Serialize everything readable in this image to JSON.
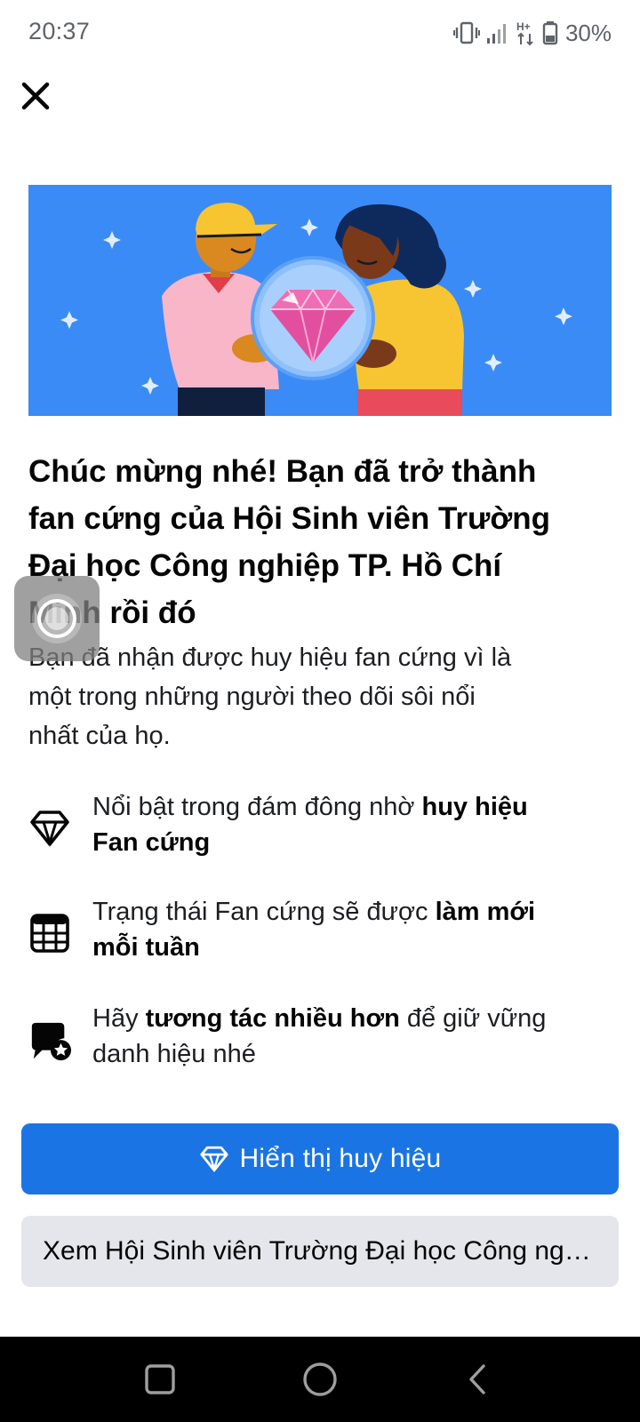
{
  "status_bar": {
    "time": "20:37",
    "battery": "30%",
    "icons": [
      "vibrate-icon",
      "signal-icon",
      "hplus-data-icon",
      "battery-icon"
    ]
  },
  "dialog": {
    "close_icon": "close-icon",
    "hero_icon": "fan-badge-illustration",
    "title_lines": [
      "Chúc mừng nhé! Bạn đã trở thành",
      "fan cứng của Hội Sinh viên Trường",
      "Đại học Công nghiệp TP. Hồ Chí",
      "Minh rồi đó"
    ],
    "subtitle_lines": [
      "Bạn đã nhận được huy hiệu fan cứng vì là",
      "một trong những người theo dõi sôi nổi",
      "nhất của họ."
    ],
    "benefits": [
      {
        "icon": "diamond-icon",
        "line1_pre": "Nổi bật trong đám đông nhờ ",
        "line1_bold": "huy hiệu",
        "line2_bold": "Fan cứng",
        "line2_post": ""
      },
      {
        "icon": "calendar-icon",
        "line1_pre": "Trạng thái Fan cứng sẽ được ",
        "line1_bold": "làm mới",
        "line2_bold": "mỗi tuần",
        "line2_post": ""
      },
      {
        "icon": "chat-badge-icon",
        "line1_pre": "Hãy ",
        "line1_bold": "tương tác nhiều hơn",
        "line1_post": " để giữ vững",
        "line2_bold": "",
        "line2_post": "danh hiệu nhé"
      }
    ],
    "primary_button": {
      "label": "Hiển thị huy hiệu",
      "icon": "diamond-icon",
      "color": "#1b74e4"
    },
    "secondary_button": {
      "label": "Xem Hội Sinh viên Trường Đại học Công nghiệp TP. Hồ Chí Minh"
    }
  },
  "floating_overlay": {
    "icon": "assistive-touch-icon"
  },
  "nav_bar": {
    "buttons": [
      "recents-icon",
      "home-icon",
      "back-icon"
    ]
  }
}
